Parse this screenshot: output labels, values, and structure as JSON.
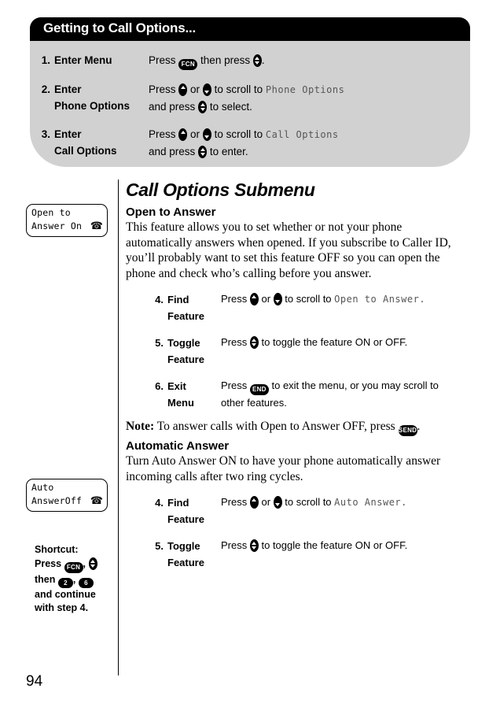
{
  "callout": {
    "title": "Getting to Call Options...",
    "steps": [
      {
        "num": "1.",
        "label": "Enter Menu",
        "desc_a": "Press",
        "key1": "FCN",
        "desc_b": "then press",
        "desc_c": "."
      },
      {
        "num": "2.",
        "label_line1": "Enter",
        "label_line2": "Phone Options",
        "desc_a": "Press",
        "desc_b": "or",
        "desc_c": "to scroll to",
        "lcd": "Phone Options",
        "desc_d": "and press",
        "desc_e": "to select."
      },
      {
        "num": "3.",
        "label_line1": "Enter",
        "label_line2": "Call Options",
        "desc_a": "Press",
        "desc_b": "or",
        "desc_c": "to scroll to",
        "lcd": "Call Options",
        "desc_d": "and press",
        "desc_e": "to enter."
      }
    ]
  },
  "lcd_open": {
    "line1": "Open to",
    "line2": "Answer On",
    "icon": "phone-icon"
  },
  "lcd_auto": {
    "line1": "Auto",
    "line2": "AnswerOff",
    "icon": "phone-icon"
  },
  "shortcut": {
    "title": "Shortcut:",
    "press_word": "Press",
    "key_fcn": "FCN",
    "then_word": "then",
    "key_2": "2",
    "key_6": "6",
    "tail_line1": "and continue",
    "tail_line2": "with step 4."
  },
  "main": {
    "heading": "Call Options Submenu",
    "section1": {
      "heading": "Open to Answer",
      "paragraph": "This feature allows you to set whether or not your phone automatically answers when opened. If you subscribe to Caller ID, you’ll probably want to set this feature OFF so you can open the phone and check who’s calling before you answer.",
      "steps": [
        {
          "num": "4.",
          "label_line1": "Find",
          "label_line2": "Feature",
          "desc_a": "Press",
          "desc_b": "or",
          "desc_c": "to scroll to",
          "lcd": "Open to Answer",
          "desc_d": "."
        },
        {
          "num": "5.",
          "label_line1": "Toggle",
          "label_line2": "Feature",
          "desc_a": "Press",
          "desc_b": "to toggle the feature ON or OFF."
        },
        {
          "num": "6.",
          "label_line1": "Exit",
          "label_line2": "Menu",
          "desc_a": "Press",
          "key": "END",
          "desc_b": "to exit the menu, or you may scroll to other features."
        }
      ],
      "note_label": "Note:",
      "note_text_a": "To answer calls with Open to Answer OFF, press",
      "note_key": "SEND",
      "note_text_b": "."
    },
    "section2": {
      "heading": "Automatic Answer",
      "paragraph": "Turn Auto Answer ON to have your phone automatically answer incoming calls after two ring cycles.",
      "steps": [
        {
          "num": "4.",
          "label_line1": "Find",
          "label_line2": "Feature",
          "desc_a": "Press",
          "desc_b": "or",
          "desc_c": "to scroll to",
          "lcd": "Auto Answer",
          "desc_d": "."
        },
        {
          "num": "5.",
          "label_line1": "Toggle",
          "label_line2": "Feature",
          "desc_a": "Press",
          "desc_b": "to toggle the feature ON or OFF."
        }
      ]
    }
  },
  "page_number": "94",
  "colors": {
    "header_bar": "#000000",
    "callout_body": "#d1d1d1",
    "text": "#000000",
    "lcd_inline": "#555555",
    "page_bg": "#ffffff"
  }
}
